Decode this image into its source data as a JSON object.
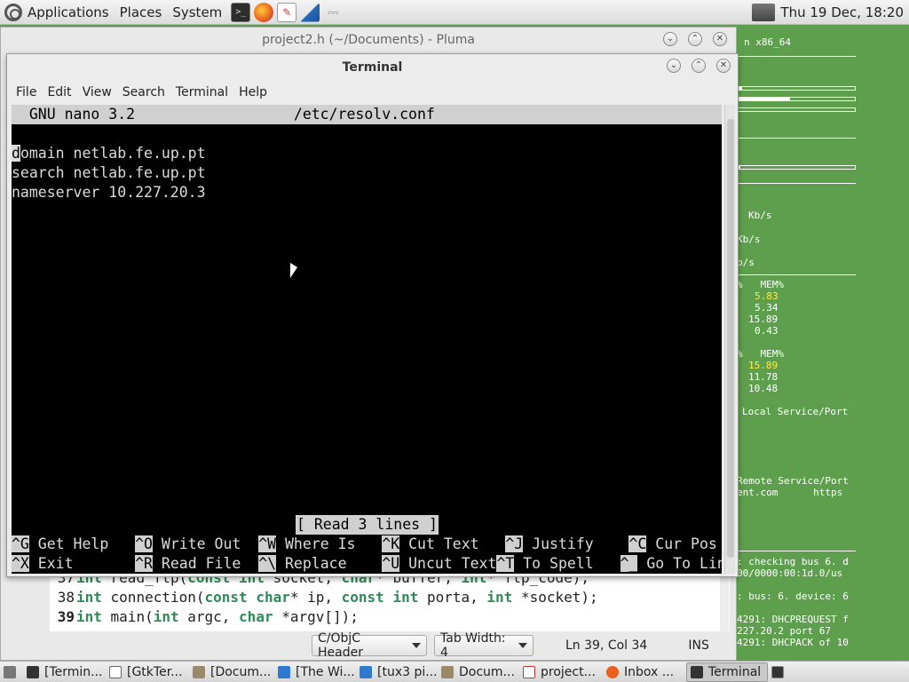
{
  "top_panel": {
    "menus": [
      "Applications",
      "Places",
      "System"
    ],
    "clock": "Thu 19 Dec, 18:20"
  },
  "conky": {
    "arch": "n x86_64",
    "net_down": "Kb/s",
    "net_up": "Kb/s",
    "net_total": "b/s",
    "mem_header_1": "%   MEM%",
    "mem_values_1": [
      "5.83",
      "5.34",
      "15.89",
      "0.43"
    ],
    "mem_header_2": "%   MEM%",
    "mem_values_2": [
      "15.89",
      "11.78",
      "10.48"
    ],
    "local_service": "Local Service/Port",
    "remote_service": "Remote Service/Port",
    "remote_entry": "ent.com      https",
    "log_lines": [
      ": checking bus 6. d",
      "00/0000:00:1d.0/us",
      ": bus: 6. device: 6",
      "4291: DHCPREQUEST f",
      "227.20.2 port 67",
      "4291: DHCPACK of 10"
    ]
  },
  "pluma": {
    "title": "project2.h (~/Documents) - Pluma",
    "code_lines": [
      {
        "num": "37",
        "text": "int read_ftp(const int socket, char* buffer, int* ftp_code);"
      },
      {
        "num": "38",
        "text": "int connection(const char* ip, const int porta, int *socket);"
      },
      {
        "num": "39",
        "text": "int main(int argc, char *argv[]);"
      }
    ],
    "language": "C/ObjC Header",
    "tab_width": "Tab Width:  4",
    "position": "Ln 39, Col 34",
    "mode": "INS"
  },
  "terminal": {
    "title": "Terminal",
    "menu": [
      "File",
      "Edit",
      "View",
      "Search",
      "Terminal",
      "Help"
    ],
    "nano_header": "  GNU nano 3.2                  /etc/resolv.conf",
    "cursor_char": "d",
    "lines": [
      "omain netlab.fe.up.pt",
      "search netlab.fe.up.pt",
      "nameserver 10.227.20.3"
    ],
    "status": "[ Read 3 lines ]",
    "shortcuts_row1": [
      {
        "key": "^G",
        "label": " Get Help   "
      },
      {
        "key": "^O",
        "label": " Write Out  "
      },
      {
        "key": "^W",
        "label": " Where Is   "
      },
      {
        "key": "^K",
        "label": " Cut Text   "
      },
      {
        "key": "^J",
        "label": " Justify    "
      },
      {
        "key": "^C",
        "label": " Cur Pos"
      }
    ],
    "shortcuts_row2": [
      {
        "key": "^X",
        "label": " Exit       "
      },
      {
        "key": "^R",
        "label": " Read File  "
      },
      {
        "key": "^\\",
        "label": " Replace    "
      },
      {
        "key": "^U",
        "label": " Uncut Text"
      },
      {
        "key": "^T",
        "label": " To Spell   "
      },
      {
        "key": "^_",
        "label": " Go To Line"
      }
    ]
  },
  "taskbar": {
    "items": [
      "[Termin...",
      "[GtkTer...",
      "[Docum...",
      "[The Wi...",
      "[tux3 pi...",
      "Docum...",
      "project...",
      "Inbox ...",
      "Terminal"
    ]
  },
  "colors": {
    "desktop": "#5e9f4d",
    "nano_bar": "#d0d0d0",
    "keyword": "#2e8b57"
  }
}
